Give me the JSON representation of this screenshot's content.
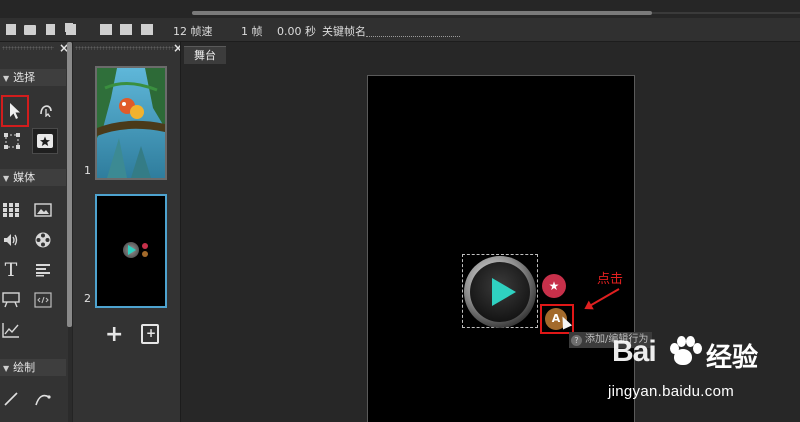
{
  "toolbar": {
    "frame_rate": "12 帧速",
    "frame_count": "1 帧",
    "time": "0.00 秒",
    "keyframe_name_label": "关键帧名"
  },
  "tools_panel": {
    "sections": [
      {
        "label": "选择"
      },
      {
        "label": "媒体"
      },
      {
        "label": "绘制"
      }
    ]
  },
  "slides_panel": {
    "slides": [
      {
        "number": "1"
      },
      {
        "number": "2"
      }
    ],
    "add_label": "+"
  },
  "stage": {
    "tab_label": "舞台",
    "tooltip": "添加/编辑行为",
    "badge_a": "A",
    "annotation": "点击"
  },
  "watermark": {
    "logo": "Bai",
    "logo_suffix": "经验",
    "url": "jingyan.baidu.com"
  },
  "colors": {
    "highlight_red": "#e01717",
    "play_teal": "#2fd1c1",
    "selected_slide_border": "#4ea3cf"
  }
}
